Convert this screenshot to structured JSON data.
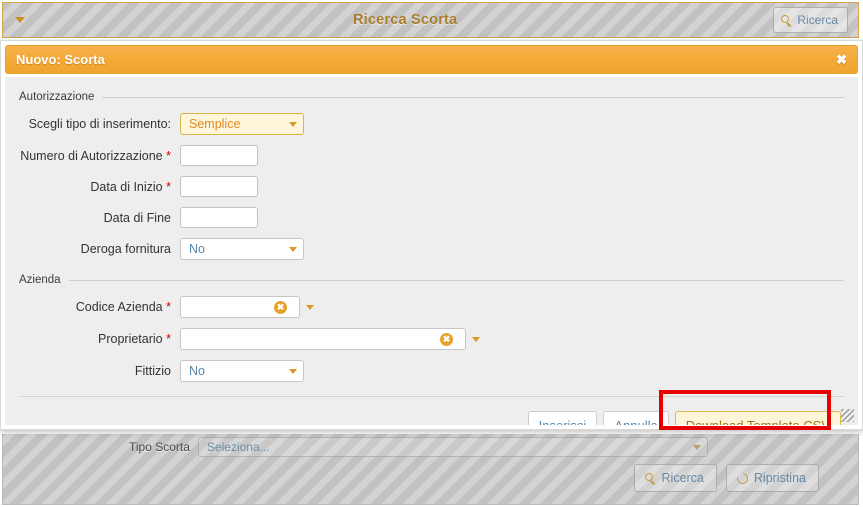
{
  "header": {
    "title": "Ricerca Scorta",
    "collapse_icon": "triangle-down-icon",
    "search_button": {
      "label": "Ricerca",
      "icon": "search-icon"
    }
  },
  "modal": {
    "title": "Nuovo: Scorta",
    "close_label": "✖",
    "groups": [
      {
        "legend": "Autorizzazione",
        "fields": [
          {
            "label": "Scegli tipo di inserimento:",
            "required": false,
            "type": "select",
            "value": "Semplice",
            "highlight": true
          },
          {
            "label": "Numero di Autorizzazione",
            "required": true,
            "type": "text",
            "value": "",
            "placeholder": ""
          },
          {
            "label": "Data di Inizio",
            "required": true,
            "type": "text",
            "value": "",
            "placeholder": ""
          },
          {
            "label": "Data di Fine",
            "required": false,
            "type": "text",
            "value": "",
            "placeholder": ""
          },
          {
            "label": "Deroga fornitura",
            "required": false,
            "type": "select",
            "value": "No",
            "highlight": false
          }
        ]
      },
      {
        "legend": "Azienda",
        "fields": [
          {
            "label": "Codice Azienda",
            "required": true,
            "type": "combo",
            "value": "",
            "placeholder": "",
            "clear_icon": "clear-circle-icon"
          },
          {
            "label": "Proprietario",
            "required": true,
            "type": "combo-wide",
            "value": "",
            "placeholder": "",
            "clear_icon": "clear-circle-icon"
          },
          {
            "label": "Fittizio",
            "required": false,
            "type": "select",
            "value": "No",
            "highlight": false
          }
        ]
      }
    ],
    "actions": {
      "insert_label": "Inserisci",
      "cancel_label": "Annulla",
      "download_label": "Download Template CSV"
    },
    "highlight_color": "#e70000"
  },
  "search_panel": {
    "tipo_scorta_label": "Tipo Scorta",
    "tipo_scorta_value": "Seleziona...",
    "buttons": [
      {
        "label": "Ricerca",
        "icon": "search-icon"
      },
      {
        "label": "Ripristina",
        "icon": "refresh-icon"
      }
    ]
  },
  "colors": {
    "accent_orange": "#f5a937",
    "gold_text": "#a87e2e",
    "link_blue": "#5a88a8",
    "required_red": "#cc0000",
    "highlight_red": "#e70000"
  }
}
